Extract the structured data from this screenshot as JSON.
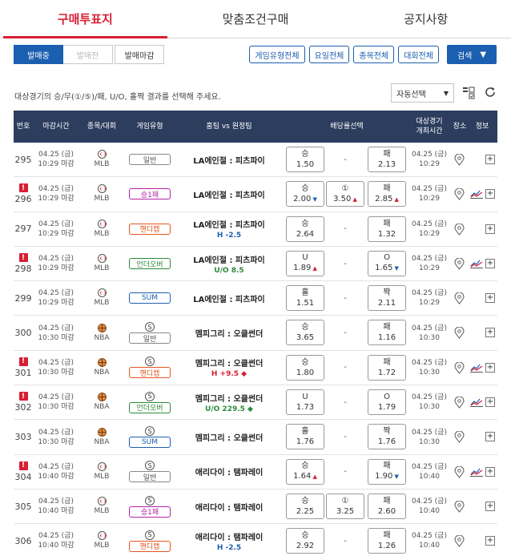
{
  "tabs": [
    "구매투표지",
    "맞춤조건구매",
    "공지사항"
  ],
  "status_tabs": [
    "발매중",
    "발매전",
    "발매마감"
  ],
  "filters": [
    "게임유형전체",
    "요일전체",
    "종목전체",
    "대회전체"
  ],
  "search": {
    "label": "검색",
    "icon": "chevron-down-icon"
  },
  "instruction": "대상경기의 승/무(①/⑤)/패, U/O, 홀짝 결과를 선택해 주세요.",
  "auto_select": "자동선택",
  "headers": {
    "no": "번호",
    "deadline": "마감시간",
    "league": "종목/대회",
    "type": "게임유형",
    "match": "홈팀 vs 원정팀",
    "odds": "배당률선택",
    "start_1": "대상경기",
    "start_2": "개최시간",
    "venue": "장소",
    "info": "정보"
  },
  "colors": {
    "accent_red": "#d81e33",
    "primary_blue": "#1b5fb0",
    "header_navy": "#2c3d5e"
  },
  "rows": [
    {
      "num": "295",
      "alert": false,
      "date": "04.25 (금)",
      "time": "10:29 마감",
      "sport": "mlb",
      "league": "MLB",
      "s_icon": false,
      "type": "일반",
      "type_style": "gray",
      "match": "LA에인절 : 피츠파이",
      "hcap": "",
      "hcap_style": "",
      "odds": [
        {
          "label": "승",
          "value": "1.50",
          "arrow": ""
        },
        {
          "dash": true
        },
        {
          "label": "패",
          "value": "2.13",
          "arrow": ""
        }
      ],
      "start_date": "04.25 (금)",
      "start_time": "10:29",
      "chart": false
    },
    {
      "num": "296",
      "alert": true,
      "date": "04.25 (금)",
      "time": "10:29 마감",
      "sport": "mlb",
      "league": "MLB",
      "s_icon": false,
      "type": "승1패",
      "type_style": "purple",
      "match": "LA에인절 : 피츠파이",
      "hcap": "",
      "hcap_style": "",
      "odds": [
        {
          "label": "승",
          "value": "2.00",
          "arrow": "▼"
        },
        {
          "label": "①",
          "value": "3.50",
          "arrow": "▲"
        },
        {
          "label": "패",
          "value": "2.85",
          "arrow": "▲"
        }
      ],
      "start_date": "04.25 (금)",
      "start_time": "10:29",
      "chart": true
    },
    {
      "num": "297",
      "alert": false,
      "date": "04.25 (금)",
      "time": "10:29 마감",
      "sport": "mlb",
      "league": "MLB",
      "s_icon": false,
      "type": "핸디캡",
      "type_style": "orange",
      "match": "LA에인절 : 피츠파이",
      "hcap": "H -2.5",
      "hcap_style": "blue",
      "odds": [
        {
          "label": "승",
          "value": "2.64",
          "arrow": ""
        },
        {
          "dash": true
        },
        {
          "label": "패",
          "value": "1.32",
          "arrow": ""
        }
      ],
      "start_date": "04.25 (금)",
      "start_time": "10:29",
      "chart": false
    },
    {
      "num": "298",
      "alert": true,
      "date": "04.25 (금)",
      "time": "10:29 마감",
      "sport": "mlb",
      "league": "MLB",
      "s_icon": false,
      "type": "언더오버",
      "type_style": "green",
      "match": "LA에인절 : 피츠파이",
      "hcap": "U/O 8.5",
      "hcap_style": "green",
      "odds": [
        {
          "label": "U",
          "value": "1.89",
          "arrow": "▲"
        },
        {
          "dash": true
        },
        {
          "label": "O",
          "value": "1.65",
          "arrow": "▼"
        }
      ],
      "start_date": "04.25 (금)",
      "start_time": "10:29",
      "chart": true
    },
    {
      "num": "299",
      "alert": false,
      "date": "04.25 (금)",
      "time": "10:29 마감",
      "sport": "mlb",
      "league": "MLB",
      "s_icon": false,
      "type": "SUM",
      "type_style": "blue",
      "match": "LA에인절 : 피츠파이",
      "hcap": "",
      "hcap_style": "",
      "odds": [
        {
          "label": "홀",
          "value": "1.51",
          "arrow": ""
        },
        {
          "dash": true
        },
        {
          "label": "짝",
          "value": "2.11",
          "arrow": ""
        }
      ],
      "start_date": "04.25 (금)",
      "start_time": "10:29",
      "chart": false
    },
    {
      "num": "300",
      "alert": false,
      "date": "04.25 (금)",
      "time": "10:30 마감",
      "sport": "nba",
      "league": "NBA",
      "s_icon": true,
      "type": "일반",
      "type_style": "gray",
      "match": "멤피그리 : 오클썬더",
      "hcap": "",
      "hcap_style": "",
      "odds": [
        {
          "label": "승",
          "value": "3.65",
          "arrow": ""
        },
        {
          "dash": true
        },
        {
          "label": "패",
          "value": "1.16",
          "arrow": ""
        }
      ],
      "start_date": "04.25 (금)",
      "start_time": "10:30",
      "chart": false
    },
    {
      "num": "301",
      "alert": true,
      "date": "04.25 (금)",
      "time": "10:30 마감",
      "sport": "nba",
      "league": "NBA",
      "s_icon": true,
      "type": "핸디캡",
      "type_style": "orange",
      "match": "멤피그리 : 오클썬더",
      "hcap": "H +9.5 ◆",
      "hcap_style": "red",
      "odds": [
        {
          "label": "승",
          "value": "1.80",
          "arrow": ""
        },
        {
          "dash": true
        },
        {
          "label": "패",
          "value": "1.72",
          "arrow": ""
        }
      ],
      "start_date": "04.25 (금)",
      "start_time": "10:30",
      "chart": true
    },
    {
      "num": "302",
      "alert": true,
      "date": "04.25 (금)",
      "time": "10:30 마감",
      "sport": "nba",
      "league": "NBA",
      "s_icon": true,
      "type": "언더오버",
      "type_style": "green",
      "match": "멤피그리 : 오클썬더",
      "hcap": "U/O 229.5 ◆",
      "hcap_style": "green",
      "odds": [
        {
          "label": "U",
          "value": "1.73",
          "arrow": ""
        },
        {
          "dash": true
        },
        {
          "label": "O",
          "value": "1.79",
          "arrow": ""
        }
      ],
      "start_date": "04.25 (금)",
      "start_time": "10:30",
      "chart": true
    },
    {
      "num": "303",
      "alert": false,
      "date": "04.25 (금)",
      "time": "10:30 마감",
      "sport": "nba",
      "league": "NBA",
      "s_icon": true,
      "type": "SUM",
      "type_style": "blue",
      "match": "멤피그리 : 오클썬더",
      "hcap": "",
      "hcap_style": "",
      "odds": [
        {
          "label": "홀",
          "value": "1.76",
          "arrow": ""
        },
        {
          "dash": true
        },
        {
          "label": "짝",
          "value": "1.76",
          "arrow": ""
        }
      ],
      "start_date": "04.25 (금)",
      "start_time": "10:30",
      "chart": false
    },
    {
      "num": "304",
      "alert": true,
      "date": "04.25 (금)",
      "time": "10:40 마감",
      "sport": "mlb",
      "league": "MLB",
      "s_icon": true,
      "type": "일반",
      "type_style": "gray",
      "match": "애리다이 : 탬파레이",
      "hcap": "",
      "hcap_style": "",
      "odds": [
        {
          "label": "승",
          "value": "1.64",
          "arrow": "▲"
        },
        {
          "dash": true
        },
        {
          "label": "패",
          "value": "1.90",
          "arrow": "▼"
        }
      ],
      "start_date": "04.25 (금)",
      "start_time": "10:40",
      "chart": true
    },
    {
      "num": "305",
      "alert": false,
      "date": "04.25 (금)",
      "time": "10:40 마감",
      "sport": "mlb",
      "league": "MLB",
      "s_icon": true,
      "type": "승1패",
      "type_style": "purple",
      "match": "애리다이 : 탬파레이",
      "hcap": "",
      "hcap_style": "",
      "odds": [
        {
          "label": "승",
          "value": "2.25",
          "arrow": ""
        },
        {
          "label": "①",
          "value": "3.25",
          "arrow": ""
        },
        {
          "label": "패",
          "value": "2.60",
          "arrow": ""
        }
      ],
      "start_date": "04.25 (금)",
      "start_time": "10:40",
      "chart": false
    },
    {
      "num": "306",
      "alert": false,
      "date": "04.25 (금)",
      "time": "10:40 마감",
      "sport": "mlb",
      "league": "MLB",
      "s_icon": true,
      "type": "핸디캡",
      "type_style": "orange",
      "match": "애리다이 : 탬파레이",
      "hcap": "H -2.5",
      "hcap_style": "blue",
      "odds": [
        {
          "label": "승",
          "value": "2.92",
          "arrow": ""
        },
        {
          "dash": true
        },
        {
          "label": "패",
          "value": "1.26",
          "arrow": ""
        }
      ],
      "start_date": "04.25 (금)",
      "start_time": "10:40",
      "chart": false
    }
  ]
}
